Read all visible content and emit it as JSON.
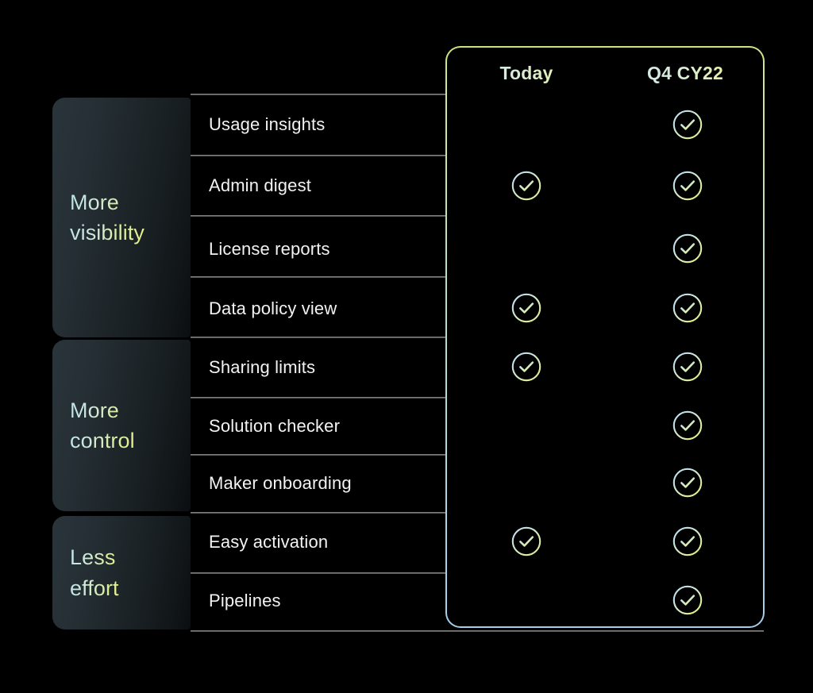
{
  "page": {
    "background_color": "#000000",
    "accent_gradient_start": "#cbe27e",
    "accent_gradient_end": "#a6cdea",
    "divider_color": "#7d7d7d",
    "label_color": "#f2f2f2",
    "card_background_start": "#2a353b",
    "card_background_end": "#0b0e10"
  },
  "table": {
    "columns": [
      {
        "id": "feature",
        "label": ""
      },
      {
        "id": "today",
        "label": "Today"
      },
      {
        "id": "future",
        "label": "Q4 CY22"
      }
    ],
    "highlighted_column": "future",
    "groups": [
      {
        "id": "more-visibility",
        "label": "More\nvisibility"
      },
      {
        "id": "more-control",
        "label": "More\ncontrol"
      },
      {
        "id": "less-effort",
        "label": "Less\neffort"
      }
    ],
    "rows": [
      {
        "label": "Usage insights",
        "group": "more-visibility",
        "today": false,
        "future": true
      },
      {
        "label": "Admin digest",
        "group": "more-visibility",
        "today": true,
        "future": true
      },
      {
        "label": "License reports",
        "group": "more-visibility",
        "today": false,
        "future": true
      },
      {
        "label": "Data policy view",
        "group": "more-visibility",
        "today": true,
        "future": true
      },
      {
        "label": "Sharing limits",
        "group": "more-control",
        "today": true,
        "future": true
      },
      {
        "label": "Solution checker",
        "group": "more-control",
        "today": false,
        "future": true
      },
      {
        "label": "Maker onboarding",
        "group": "more-control",
        "today": false,
        "future": true
      },
      {
        "label": "Easy activation",
        "group": "less-effort",
        "today": true,
        "future": true
      },
      {
        "label": "Pipelines",
        "group": "less-effort",
        "today": false,
        "future": true
      }
    ],
    "check_icon_name": "check-circle-icon"
  }
}
